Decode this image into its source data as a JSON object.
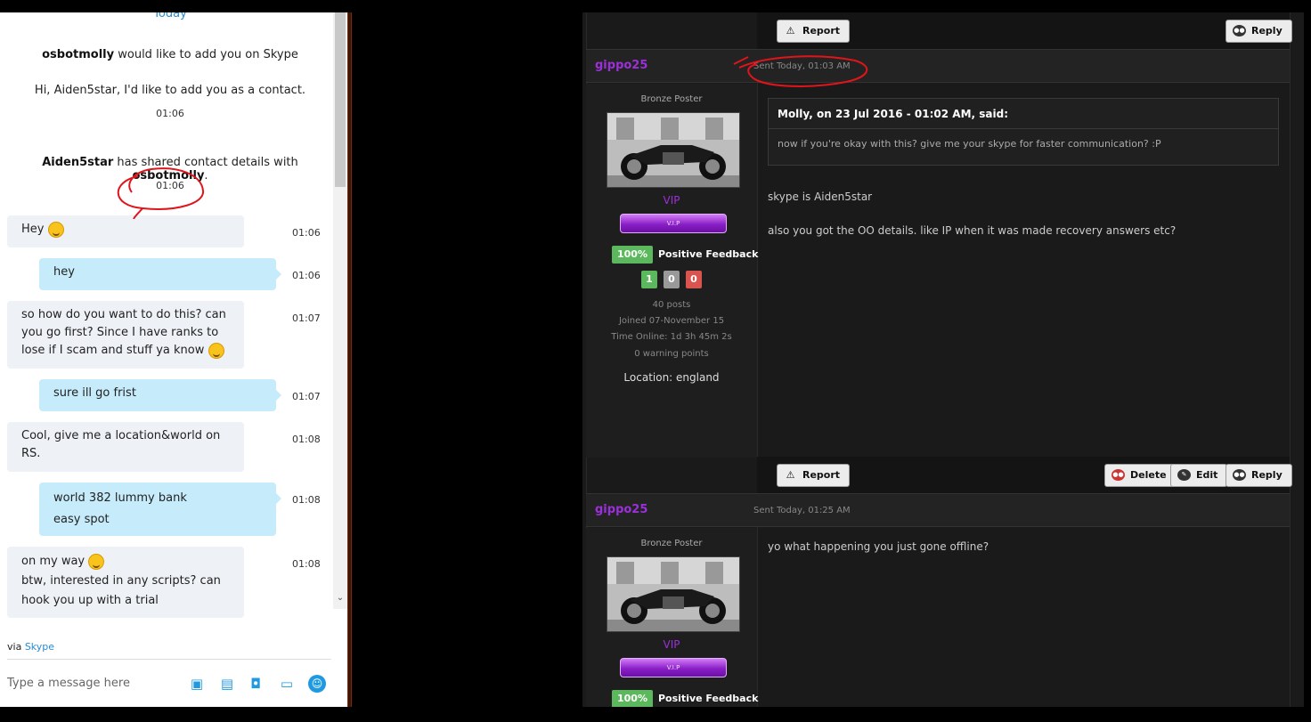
{
  "skype": {
    "today_label": "Today",
    "request_name": "osbotmolly",
    "request_text": " would like to add you on Skype",
    "request_message": "Hi, Aiden5star, I'd like to add you as a contact.",
    "request_time": "01:06",
    "share_user": "Aiden5star",
    "share_text": " has shared contact details with ",
    "share_target": "osbotmolly",
    "share_suffix": ".",
    "share_time": "01:06",
    "messages": [
      {
        "dir": "in",
        "text": "Hey",
        "emoji": true,
        "time": "01:06"
      },
      {
        "dir": "out",
        "text": "hey",
        "time": "01:06"
      },
      {
        "dir": "in",
        "line1": "so how do you want to do this? can",
        "line2": "you go first? Since I have ranks to",
        "line3": "lose if I scam and stuff ya know",
        "time": "01:07"
      },
      {
        "dir": "out",
        "text": "sure ill go frist",
        "time": "01:07"
      },
      {
        "dir": "in",
        "line1": "Cool, give me a location&world on",
        "line2": "RS.",
        "time": "01:08"
      },
      {
        "dir": "out",
        "line1": "world 382 lummy bank",
        "line2": "easy spot",
        "time": "01:08"
      },
      {
        "dir": "in",
        "line1": "on my way",
        "line2": "btw, interested in any scripts? can",
        "line3": "hook you up with a trial",
        "time": "01:08"
      }
    ],
    "via_prefix": "via ",
    "via_link": "Skype",
    "input_placeholder": "Type a message here",
    "icons": [
      "camera-icon",
      "file-icon",
      "video-message-icon",
      "contact-card-icon",
      "emoticon-icon"
    ],
    "accent": "#2a8bd0"
  },
  "forum": {
    "top_buttons": {
      "report": "Report",
      "reply": "Reply"
    },
    "posts": [
      {
        "username": "gippo25",
        "sent": "Sent Today, 01:03 AM",
        "rank": "Bronze Poster",
        "group": "VIP",
        "vip_badge": "V.I.P",
        "feedback_pct": "100%",
        "feedback_label": "Positive Feedback",
        "fb_pos": "1",
        "fb_neu": "0",
        "fb_neg": "0",
        "posts": "40 posts",
        "joined": "Joined 07-November 15",
        "time_online": "Time Online: 1d 3h 45m 2s",
        "warning": "0 warning points",
        "location": "Location: england",
        "quote_head": "Molly, on 23 Jul 2016 - 01:02 AM, said:",
        "quote_body": "now if you're okay with this? give me your skype for faster communication? :P",
        "body1": "skype is Aiden5star",
        "body2": "also you got the OO details. like IP when it was made recovery answers etc?",
        "buttons": {
          "report": "Report",
          "delete": "Delete",
          "edit": "Edit",
          "reply": "Reply"
        }
      },
      {
        "username": "gippo25",
        "sent": "Sent Today, 01:25 AM",
        "rank": "Bronze Poster",
        "group": "VIP",
        "vip_badge": "V.I.P",
        "feedback_pct": "100%",
        "feedback_label": "Positive Feedback",
        "body1": "yo what happening you just gone offline?"
      }
    ],
    "username_color": "#9b30d9"
  }
}
